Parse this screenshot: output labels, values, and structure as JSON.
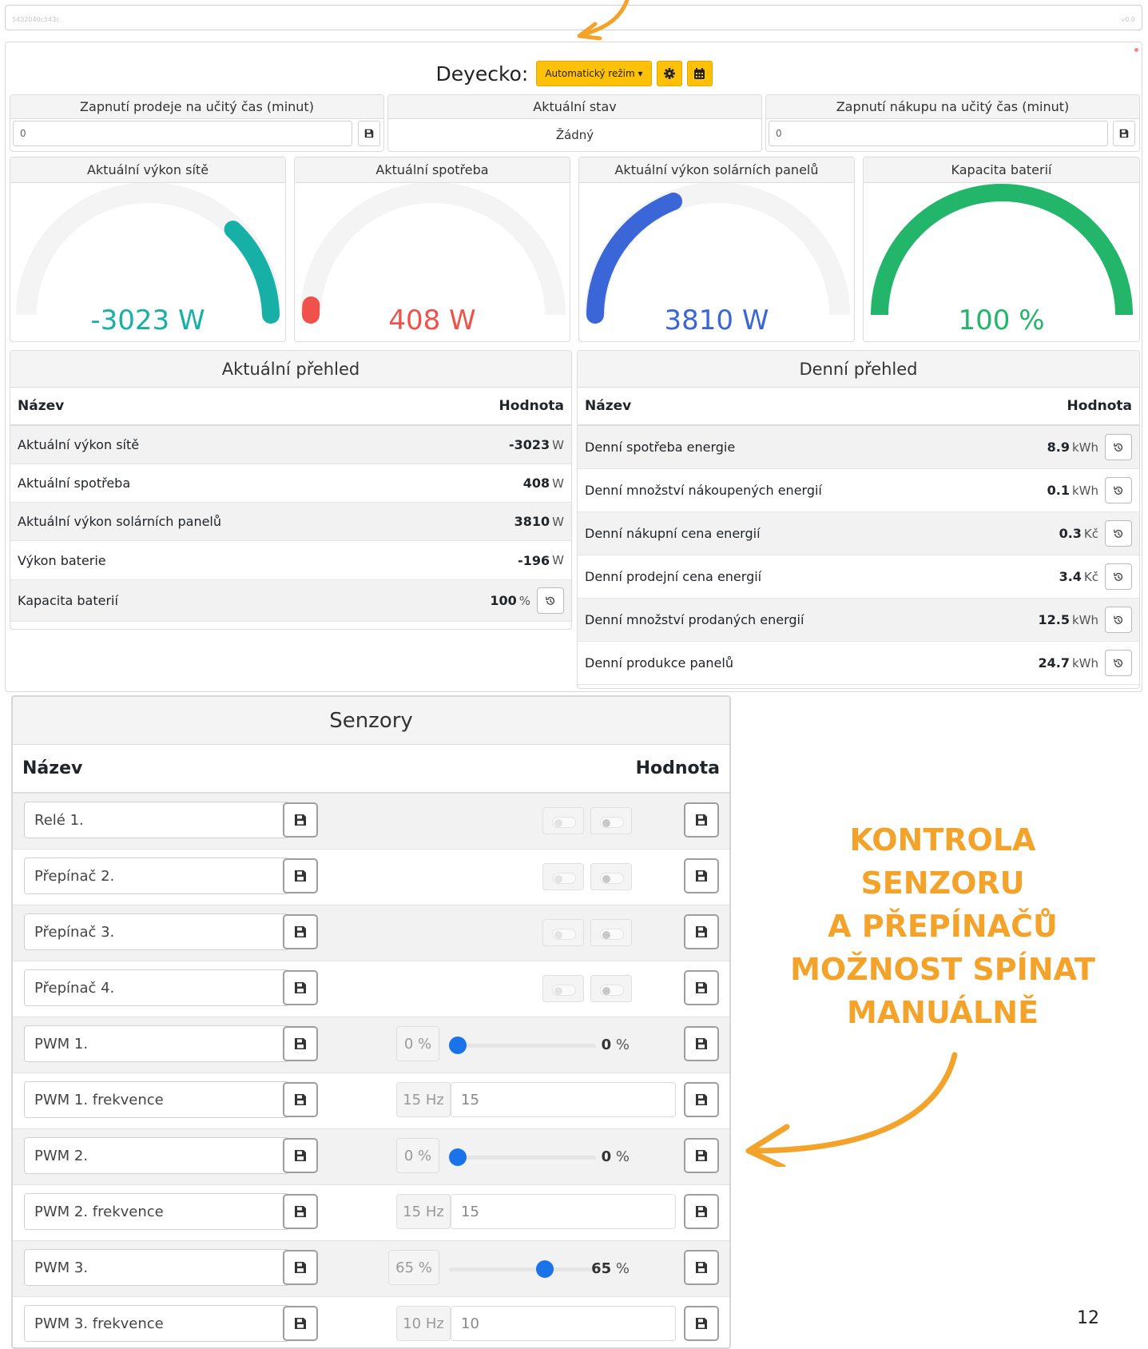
{
  "top_strip": {
    "id_text": "5432040c543c",
    "version_text": "v0.0"
  },
  "header": {
    "title": "Deyecko:",
    "mode_button": "Automatický režim ▾",
    "settings_icon": "gear-icon",
    "calendar_icon": "calendar-icon"
  },
  "controls": {
    "sell_label": "Zapnutí prodeje na učitý čas (minut)",
    "sell_value": "0",
    "state_label": "Aktuální stav",
    "state_value": "Žádný",
    "buy_label": "Zapnutí nákupu na učitý čas (minut)",
    "buy_value": "0"
  },
  "gauges": [
    {
      "title": "Aktuální výkon sítě",
      "value_text": "-3023 W",
      "color": "#17b0a7"
    },
    {
      "title": "Aktuální spotřeba",
      "value_text": "408 W",
      "color": "#f0524b"
    },
    {
      "title": "Aktuální výkon solárních panelů",
      "value_text": "3810 W",
      "color": "#3b66d8"
    },
    {
      "title": "Kapacita baterií",
      "value_text": "100 %",
      "color": "#23b56a"
    }
  ],
  "current": {
    "title": "Aktuální přehled",
    "col_name": "Název",
    "col_value": "Hodnota",
    "rows": [
      {
        "name": "Aktuální výkon sítě",
        "value": "-3023",
        "unit": "W"
      },
      {
        "name": "Aktuální spotřeba",
        "value": "408",
        "unit": "W"
      },
      {
        "name": "Aktuální výkon solárních panelů",
        "value": "3810",
        "unit": "W"
      },
      {
        "name": "Výkon baterie",
        "value": "-196",
        "unit": "W"
      },
      {
        "name": "Kapacita baterií",
        "value": "100",
        "unit": "%"
      }
    ]
  },
  "daily": {
    "title": "Denní přehled",
    "col_name": "Název",
    "col_value": "Hodnota",
    "rows": [
      {
        "name": "Denní spotřeba energie",
        "value": "8.9",
        "unit": "kWh"
      },
      {
        "name": "Denní množství nákoupených energií",
        "value": "0.1",
        "unit": "kWh"
      },
      {
        "name": "Denní nákupní cena energií",
        "value": "0.3",
        "unit": "Kč"
      },
      {
        "name": "Denní prodejní cena energií",
        "value": "3.4",
        "unit": "Kč"
      },
      {
        "name": "Denní množství prodaných energií",
        "value": "12.5",
        "unit": "kWh"
      },
      {
        "name": "Denní produkce panelů",
        "value": "24.7",
        "unit": "kWh"
      }
    ]
  },
  "sensors": {
    "title": "Senzory",
    "col_name": "Název",
    "col_value": "Hodnota",
    "rows": [
      {
        "name": "Relé 1.",
        "type": "toggle"
      },
      {
        "name": "Přepínač 2.",
        "type": "toggle"
      },
      {
        "name": "Přepínač 3.",
        "type": "toggle"
      },
      {
        "name": "Přepínač 4.",
        "type": "toggle"
      },
      {
        "name": "PWM 1.",
        "type": "slider",
        "box": "0 %",
        "value": "0",
        "unit": "%",
        "level": 0
      },
      {
        "name": "PWM 1. frekvence",
        "type": "freq",
        "box": "15 Hz",
        "value": "15"
      },
      {
        "name": "PWM 2.",
        "type": "slider",
        "box": "0 %",
        "value": "0",
        "unit": "%",
        "level": 0
      },
      {
        "name": "PWM 2. frekvence",
        "type": "freq",
        "box": "15 Hz",
        "value": "15"
      },
      {
        "name": "PWM 3.",
        "type": "slider",
        "box": "65 %",
        "value": "65",
        "unit": "%",
        "level": 0.65
      },
      {
        "name": "PWM 3. frekvence",
        "type": "freq",
        "box": "10 Hz",
        "value": "10"
      }
    ]
  },
  "annotation": {
    "lines": [
      "KONTROLA",
      "SENZORU",
      "A PŘEPÍNAČŮ",
      "MOŽNOST SPÍNAT",
      "MANUÁLNĚ"
    ],
    "color": "#f4a32a"
  },
  "page_number": "12"
}
